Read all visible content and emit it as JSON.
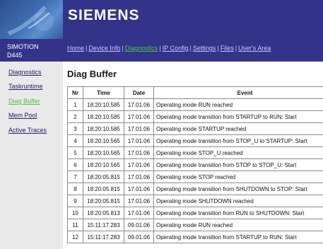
{
  "header": {
    "brand": "SIEMENS"
  },
  "device": {
    "line1": "SIMOTION",
    "line2": "D445"
  },
  "nav": {
    "items": [
      {
        "label": "Home",
        "active": false
      },
      {
        "label": "Device Info",
        "active": false
      },
      {
        "label": "Diagnostics",
        "active": true
      },
      {
        "label": "IP Config",
        "active": false
      },
      {
        "label": "Settings",
        "active": false
      },
      {
        "label": "Files",
        "active": false
      },
      {
        "label": "User's Area",
        "active": false
      }
    ]
  },
  "sidebar": {
    "items": [
      {
        "label": "Diagnostics",
        "active": false
      },
      {
        "label": "Taskruntime",
        "active": false
      },
      {
        "label": "Diag Buffer",
        "active": true
      },
      {
        "label": "Mem Pool",
        "active": false
      },
      {
        "label": "Active Traces",
        "active": false
      }
    ]
  },
  "main": {
    "title": "Diag Buffer",
    "table": {
      "headers": [
        "Nr",
        "Time",
        "Date",
        "Event"
      ],
      "rows": [
        [
          "1",
          "18:20:10.585",
          "17.01.06",
          "Operating mode RUN reached"
        ],
        [
          "2",
          "18:20:10.585",
          "17.01.06",
          "Operating mode transition from STARTUP to RUN: Start"
        ],
        [
          "3",
          "18:20:10.585",
          "17.01.06",
          "Operating mode STARTUP reached"
        ],
        [
          "4",
          "18:20:10.565",
          "17.01.06",
          "Operating mode transition from STOP_U to STARTUP: Start"
        ],
        [
          "5",
          "18:20:10.565",
          "17.01.06",
          "Operating mode STOP_U reached"
        ],
        [
          "6",
          "18:20:10.565",
          "17.01.06",
          "Operating mode transition from STOP to STOP_U: Start"
        ],
        [
          "7",
          "18:20:05.815",
          "17.01.06",
          "Operating mode STOP reached"
        ],
        [
          "8",
          "18:20:05.815",
          "17.01.06",
          "Operating mode transition from SHUTDOWN to STOP: Start"
        ],
        [
          "9",
          "18:20:05.815",
          "17.01.06",
          "Operating mode SHUTDOWN reached"
        ],
        [
          "10",
          "18:20:05.813",
          "17.01.06",
          "Operating mode transition from RUN to SHUTDOWN: Start"
        ],
        [
          "11",
          "15:11:17.283",
          "09.01.06",
          "Operating mode RUN reached"
        ],
        [
          "12",
          "15:11:17.283",
          "09.01.06",
          "Operating mode transition from STARTUP to RUN: Start"
        ]
      ]
    }
  },
  "colors": {
    "header_bg": "#33338a",
    "active_link": "#4fc24a",
    "sidebar_bg": "#e9e9e9"
  }
}
